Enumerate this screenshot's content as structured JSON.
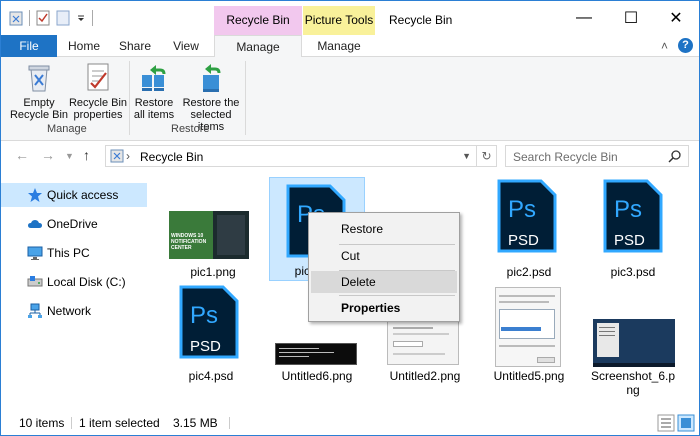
{
  "window": {
    "title": "Recycle Bin",
    "context_tabs": {
      "recycle_bin_tools": "Recycle Bin Tools",
      "picture_tools": "Picture Tools"
    },
    "controls": {
      "minimize": "—",
      "maximize": "☐",
      "close": "✕"
    }
  },
  "ribbon": {
    "tabs": [
      "File",
      "Home",
      "Share",
      "View",
      "Manage",
      "Manage"
    ],
    "manage_group": {
      "label": "Manage",
      "empty_bin": "Empty\nRecycle Bin",
      "properties": "Recycle Bin\nproperties"
    },
    "restore_group": {
      "label": "Restore",
      "restore_all": "Restore\nall items",
      "restore_selected": "Restore the\nselected items"
    },
    "help": "?",
    "collapse": "˄"
  },
  "address": {
    "path_sep": "›",
    "location": "Recycle Bin",
    "search_placeholder": "Search Recycle Bin"
  },
  "sidebar": {
    "items": [
      {
        "label": "Quick access",
        "icon": "star-icon"
      },
      {
        "label": "OneDrive",
        "icon": "cloud-icon"
      },
      {
        "label": "This PC",
        "icon": "computer-icon"
      },
      {
        "label": "Local Disk (C:)",
        "icon": "drive-icon"
      },
      {
        "label": "Network",
        "icon": "network-icon"
      }
    ]
  },
  "files": [
    {
      "name": "pic1.png",
      "type": "image"
    },
    {
      "name": "pic",
      "type": "psd",
      "selected": true
    },
    {
      "name": "pic2.psd",
      "type": "psd"
    },
    {
      "name": "pic3.psd",
      "type": "psd"
    },
    {
      "name": "pic4.psd",
      "type": "psd"
    },
    {
      "name": "Untitled6.png",
      "type": "image"
    },
    {
      "name": "Untitled2.png",
      "type": "image"
    },
    {
      "name": "Untitled5.png",
      "type": "image"
    },
    {
      "name": "Screenshot_6.p\nng",
      "type": "image"
    }
  ],
  "ps_labels": {
    "top": "Ps",
    "bottom": "PSD"
  },
  "thumb_text": "WINDOWS 10\nNOTIFICATION\nCENTER",
  "context_menu": {
    "items": [
      "Restore",
      "Cut",
      "Delete",
      "Properties"
    ]
  },
  "status": {
    "count": "10 items",
    "selection": "1 item selected",
    "size": "3.15 MB"
  },
  "colors": {
    "accent": "#1e73c5",
    "ps_blue": "#31a8ff",
    "ps_bg": "#001e36",
    "selection": "#cce8ff"
  }
}
